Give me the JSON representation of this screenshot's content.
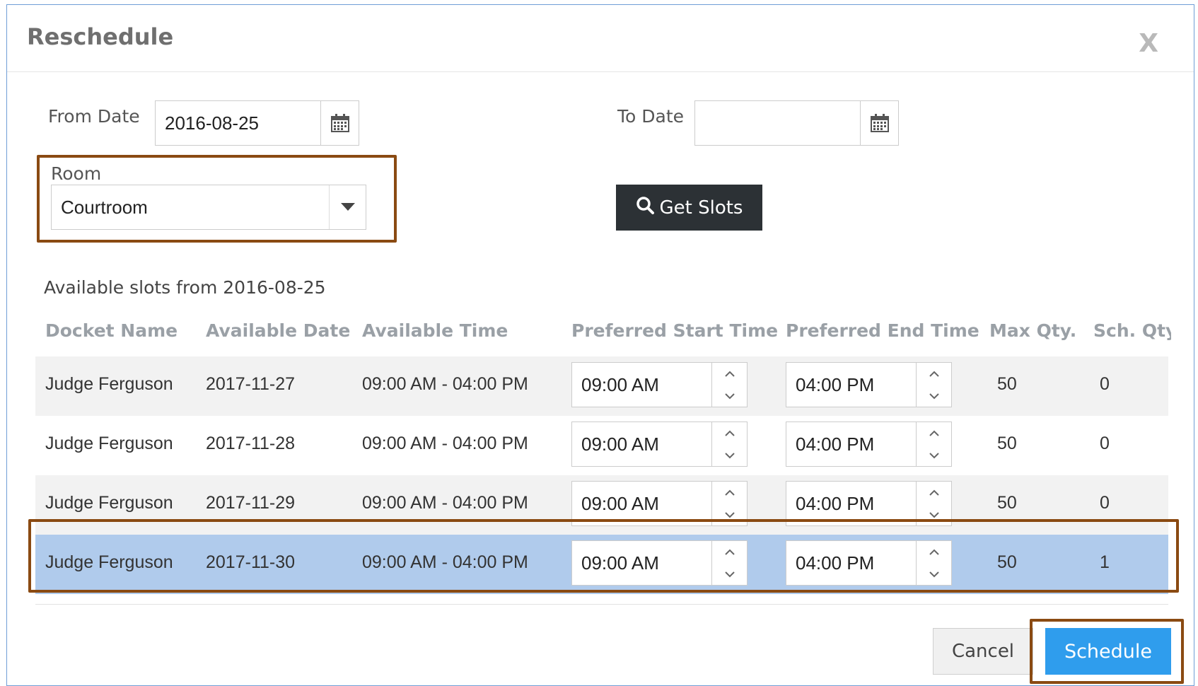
{
  "dialog": {
    "title": "Reschedule",
    "close_label": "X"
  },
  "from_date": {
    "label": "From Date",
    "value": "2016-08-25",
    "icon": "calendar-icon"
  },
  "to_date": {
    "label": "To Date",
    "value": "",
    "icon": "calendar-icon"
  },
  "room": {
    "label": "Room",
    "selected": "Courtroom"
  },
  "get_slots": {
    "label": "Get Slots",
    "icon": "search-icon"
  },
  "slots_caption": "Available slots from 2016-08-25",
  "table": {
    "headers": [
      "Docket Name",
      "Available Date",
      "Available Time",
      "Preferred Start Time",
      "Preferred End Time",
      "Max Qty.",
      "Sch. Qty"
    ],
    "rows": [
      {
        "docket": "Judge Ferguson",
        "date": "2017-11-27",
        "time": "09:00 AM - 04:00 PM",
        "start": "09:00 AM",
        "end": "04:00 PM",
        "max": "50",
        "sch": "0"
      },
      {
        "docket": "Judge Ferguson",
        "date": "2017-11-28",
        "time": "09:00 AM - 04:00 PM",
        "start": "09:00 AM",
        "end": "04:00 PM",
        "max": "50",
        "sch": "0"
      },
      {
        "docket": "Judge Ferguson",
        "date": "2017-11-29",
        "time": "09:00 AM - 04:00 PM",
        "start": "09:00 AM",
        "end": "04:00 PM",
        "max": "50",
        "sch": "0"
      },
      {
        "docket": "Judge Ferguson",
        "date": "2017-11-30",
        "time": "09:00 AM - 04:00 PM",
        "start": "09:00 AM",
        "end": "04:00 PM",
        "max": "50",
        "sch": "1"
      }
    ]
  },
  "buttons": {
    "cancel": "Cancel",
    "schedule": "Schedule"
  },
  "colors": {
    "highlight": "#8a4a12",
    "primary": "#2f9ded",
    "selected_row": "#b0cbec",
    "dark_button": "#2c3135"
  }
}
